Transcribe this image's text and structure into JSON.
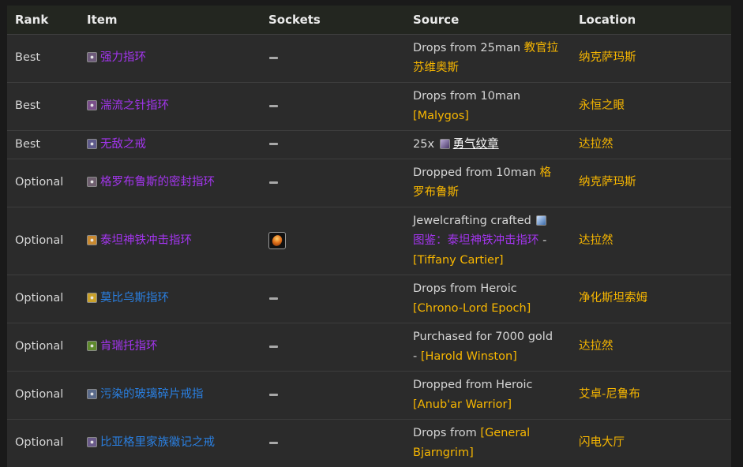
{
  "columns": [
    "Rank",
    "Item",
    "Sockets",
    "Source",
    "Location"
  ],
  "colors": {
    "epic": "#a335ee",
    "rare": "#2a7fe0",
    "source_link": "#f8b700",
    "location": "#f8b700"
  },
  "rows": [
    {
      "rank": "Best",
      "item": "强力指环",
      "quality": "epic",
      "icon": "ring-icon",
      "sockets": "none",
      "source": [
        {
          "t": "Drops from 25man ",
          "c": "src-text"
        },
        {
          "t": "教官拉苏维奥斯",
          "c": "gold"
        }
      ],
      "location": "纳克萨玛斯"
    },
    {
      "rank": "Best",
      "item": "湍流之针指环",
      "quality": "epic",
      "icon": "ring-icon",
      "sockets": "none",
      "source": [
        {
          "t": "Drops from 10man ",
          "c": "src-text"
        },
        {
          "t": "[Malygos]",
          "c": "gold"
        }
      ],
      "location": "永恒之眼"
    },
    {
      "rank": "Best",
      "item": "无敌之戒",
      "quality": "epic",
      "icon": "ring-icon",
      "sockets": "none",
      "source": [
        {
          "t": "25x ",
          "c": "src-text"
        },
        {
          "t": "勇气纹章",
          "c": "link",
          "icon": "emblem-icon"
        }
      ],
      "location": "达拉然"
    },
    {
      "rank": "Optional",
      "item": "格罗布鲁斯的密封指环",
      "quality": "epic",
      "icon": "ring-icon",
      "sockets": "none",
      "source": [
        {
          "t": "Dropped from 10man ",
          "c": "src-text"
        },
        {
          "t": "格罗布鲁斯",
          "c": "gold"
        }
      ],
      "location": "纳克萨玛斯"
    },
    {
      "rank": "Optional",
      "item": "泰坦神铁冲击指环",
      "quality": "epic",
      "icon": "ring-icon",
      "sockets": "gem",
      "source": [
        {
          "t": "Jewelcrafting crafted ",
          "c": "src-text"
        },
        {
          "t": "图鉴：泰坦神铁冲击指环",
          "c": "purple",
          "icon": "recipe-icon"
        },
        {
          "t": " - ",
          "c": "src-text"
        },
        {
          "t": "[Tiffany Cartier]",
          "c": "gold"
        }
      ],
      "location": "达拉然"
    },
    {
      "rank": "Optional",
      "item": "莫比乌斯指环",
      "quality": "rare",
      "icon": "ring-icon",
      "sockets": "none",
      "source": [
        {
          "t": "Drops from Heroic ",
          "c": "src-text"
        },
        {
          "t": "[Chrono-Lord Epoch]",
          "c": "gold"
        }
      ],
      "location": "净化斯坦索姆"
    },
    {
      "rank": "Optional",
      "item": "肯瑞托指环",
      "quality": "epic",
      "icon": "ring-icon",
      "sockets": "none",
      "source": [
        {
          "t": "Purchased for 7000 gold - ",
          "c": "src-text"
        },
        {
          "t": "[Harold Winston]",
          "c": "gold"
        }
      ],
      "location": "达拉然"
    },
    {
      "rank": "Optional",
      "item": "污染的玻璃碎片戒指",
      "quality": "rare",
      "icon": "ring-icon",
      "sockets": "none",
      "source": [
        {
          "t": "Dropped from Heroic ",
          "c": "src-text"
        },
        {
          "t": "[Anub'ar Warrior]",
          "c": "gold"
        }
      ],
      "location": "艾卓-尼鲁布"
    },
    {
      "rank": "Optional",
      "item": "比亚格里家族徽记之戒",
      "quality": "rare",
      "icon": "ring-icon",
      "sockets": "none",
      "source": [
        {
          "t": "Drops from ",
          "c": "src-text"
        },
        {
          "t": "[General Bjarngrim]",
          "c": "gold"
        }
      ],
      "location": "闪电大厅"
    }
  ],
  "row_icon_colors": [
    "#6d5a7a",
    "#7a4f8a",
    "#5e5a8a",
    "#6f5f6f",
    "#c9892f",
    "#caa12a",
    "#5f8a2d",
    "#5a6a8a",
    "#6a5a8a"
  ]
}
